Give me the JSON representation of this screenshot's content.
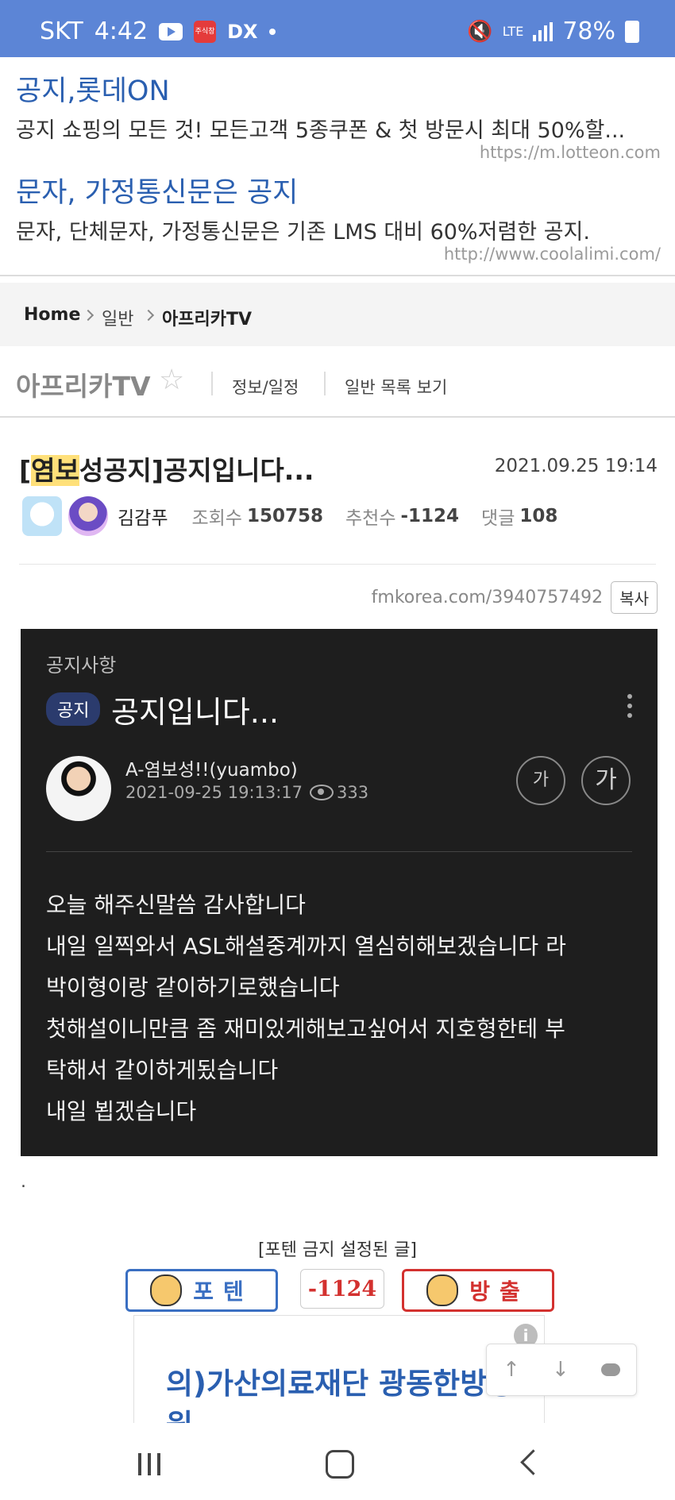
{
  "status_bar": {
    "carrier": "SKT",
    "time": "4:42",
    "app_label": "주식창",
    "dx_label": "DX",
    "network": "LTE",
    "battery": "78%"
  },
  "ads": [
    {
      "title": "공지,롯데ON",
      "desc": "공지 쇼핑의 모든 것! 모든고객 5종쿠폰 & 첫 방문시 최대 50%할...",
      "url": "https://m.lotteon.com"
    },
    {
      "title": "문자, 가정통신문은 공지",
      "desc": "문자, 단체문자, 가정통신문은 기존 LMS 대비 60%저렴한 공지.",
      "url": "http://www.coolalimi.com/"
    }
  ],
  "breadcrumb": {
    "home": "Home",
    "general": "일반",
    "current": "아프리카TV"
  },
  "board": {
    "title": "아프리카TV",
    "info_link": "정보/일정",
    "list_link": "일반 목록 보기"
  },
  "post": {
    "title_highlight": "염보",
    "title_prefix": "[",
    "title_rest": "성공지]공지입니다...",
    "date": "2021.09.25 19:14",
    "author": "김감푸",
    "views_label": "조회수",
    "views": "150758",
    "recommend_label": "추천수",
    "recommend": "-1124",
    "comments_label": "댓글",
    "comments": "108",
    "url": "fmkorea.com/3940757492",
    "copy_label": "복사"
  },
  "embedded": {
    "section": "공지사항",
    "badge": "공지",
    "title": "공지입니다...",
    "author": "A-염보성!!(yuambo)",
    "time": "2021-09-25 19:13:17",
    "views": "333",
    "font_small": "가",
    "font_large": "가",
    "body_lines": [
      "오늘 해주신말씀 감사합니다",
      "내일 일찍와서 ASL해설중계까지 열심히해보겠습니다 라",
      "박이형이랑 같이하기로했습니다",
      "첫해설이니만큼 좀 재미있게해보고싶어서 지호형한테 부",
      "탁해서 같이하게됬습니다",
      "내일 뵙겠습니다"
    ]
  },
  "after_body": ".",
  "vote": {
    "notice": "[포텐 금지 설정된 글]",
    "up_label": "포텐",
    "count": "-1124",
    "down_label": "방출"
  },
  "bottom_ad": {
    "text": "의)가산의료재단 광동한방병원",
    "info": "i"
  },
  "float_nav": {
    "up": "↑",
    "down": "↓"
  }
}
